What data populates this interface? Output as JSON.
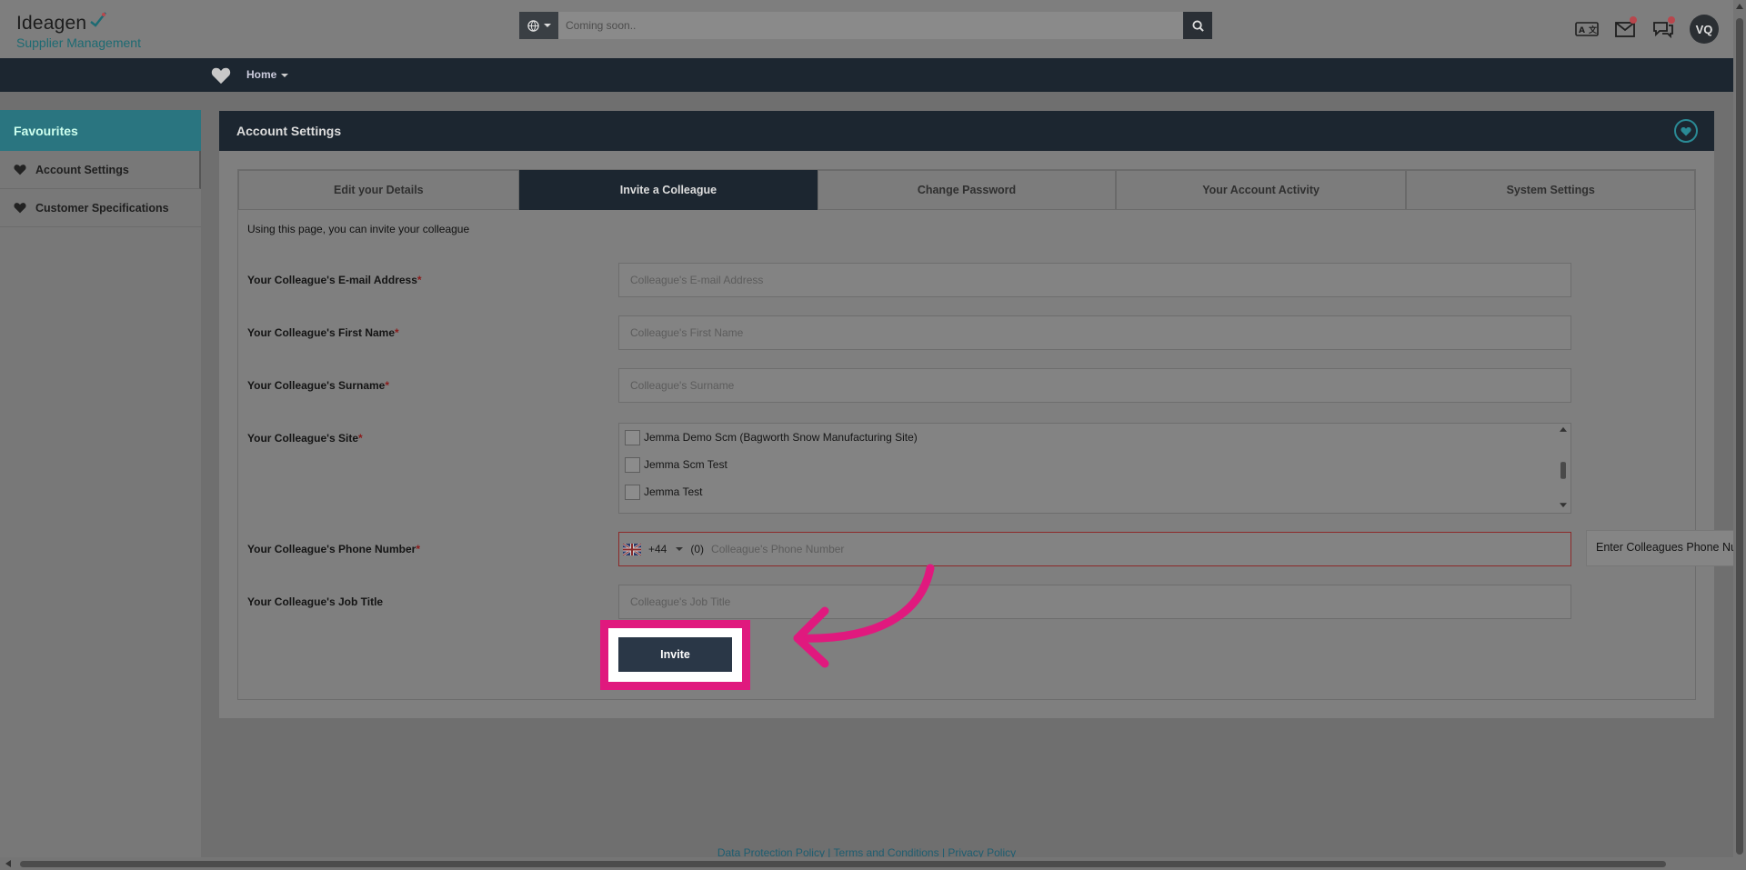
{
  "brand": {
    "name": "Ideagen",
    "product": "Supplier Management"
  },
  "search": {
    "placeholder": "Coming soon.."
  },
  "user": {
    "initials": "VQ"
  },
  "nav": {
    "home_label": "Home"
  },
  "sidebar": {
    "heading": "Favourites",
    "items": [
      {
        "label": "Account Settings"
      },
      {
        "label": "Customer Specifications"
      }
    ]
  },
  "panel": {
    "title": "Account Settings"
  },
  "tabs": [
    {
      "label": "Edit your Details"
    },
    {
      "label": "Invite a Colleague"
    },
    {
      "label": "Change Password"
    },
    {
      "label": "Your Account Activity"
    },
    {
      "label": "System Settings"
    }
  ],
  "form": {
    "intro": "Using this page, you can invite your colleague",
    "required_mark": "*",
    "email": {
      "label": "Your Colleague's E-mail Address",
      "placeholder": "Colleague's E-mail Address"
    },
    "first_name": {
      "label": "Your Colleague's First Name",
      "placeholder": "Colleague's First Name"
    },
    "surname": {
      "label": "Your Colleague's Surname",
      "placeholder": "Colleague's Surname"
    },
    "site": {
      "label": "Your Colleague's Site",
      "options": [
        "Jemma Demo Scm (Bagworth Snow Manufacturing Site)",
        "Jemma Scm Test",
        "Jemma Test"
      ]
    },
    "phone": {
      "label": "Your Colleague's Phone Number",
      "country_code": "+44",
      "trunk_prefix": "(0)",
      "placeholder": "Colleague's Phone Number"
    },
    "job_title": {
      "label": "Your Colleague's Job Title",
      "placeholder": "Colleague's Job Title"
    },
    "invite_label": "Invite"
  },
  "tooltip": {
    "text": "Enter Colleagues Phone Nu"
  },
  "footer": {
    "links": [
      "Data Protection Policy",
      "Terms and Conditions",
      "Privacy Policy"
    ],
    "separator": "|"
  },
  "colors": {
    "accent": "#2a7580",
    "navy": "#1c2630",
    "highlight": "#e0197e",
    "button": "#2a3747"
  }
}
